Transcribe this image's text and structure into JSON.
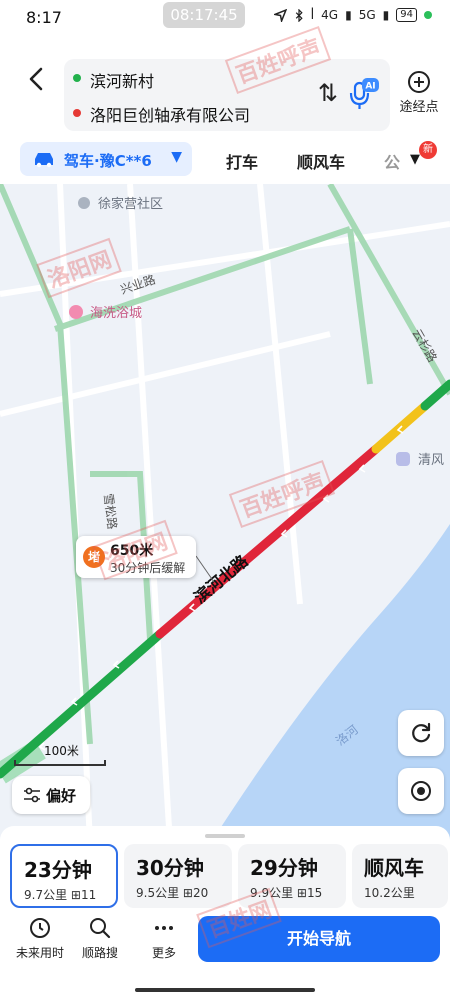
{
  "status_bar": {
    "time": "8:17",
    "center_time": "08:17:45",
    "battery": "94",
    "net1": "4G",
    "net2": "5G"
  },
  "route": {
    "origin": "滨河新村",
    "destination": "洛阳巨创轴承有限公司",
    "via_label": "途经点",
    "ai_label": "AI"
  },
  "modes": {
    "active": "驾车·豫C**6",
    "items": [
      "打车",
      "顺风车"
    ],
    "overflow": "公",
    "badge": "新"
  },
  "map": {
    "pois": [
      "徐家营社区",
      "海洗浴城",
      "清风"
    ],
    "roads": [
      "兴业路",
      "雪松路",
      "云杉路",
      "滨河北路"
    ],
    "river": "洛河",
    "jam": {
      "icon": "堵",
      "distance": "650米",
      "eta": "30分钟后缓解"
    },
    "scale": "100米",
    "pref_label": "偏好"
  },
  "options": [
    {
      "time": "23分钟",
      "distance": "9.7公里",
      "lights": "11"
    },
    {
      "time": "30分钟",
      "distance": "9.5公里",
      "lights": "20"
    },
    {
      "time": "29分钟",
      "distance": "9.9公里",
      "lights": "15"
    },
    {
      "time": "顺风车",
      "distance": "10.2公里",
      "lights": ""
    }
  ],
  "actions": {
    "future": "未来用时",
    "along": "顺路搜",
    "more": "更多",
    "start": "开始导航"
  },
  "watermarks": [
    "百姓呼声",
    "洛阳网",
    "百姓呼声",
    "洛阳网",
    "百姓网"
  ],
  "colors": {
    "accent": "#1c6cf5",
    "traffic_red": "#e0263a",
    "traffic_green": "#1fa84a",
    "traffic_yellow": "#f2c21b",
    "river": "#b7d5f7"
  }
}
